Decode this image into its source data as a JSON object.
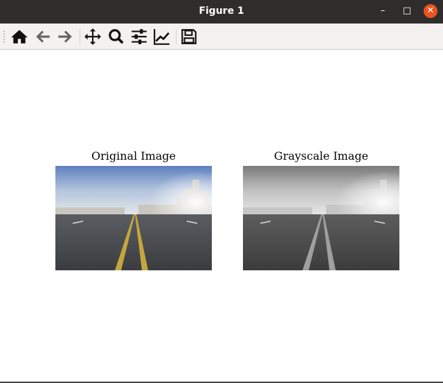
{
  "window": {
    "title": "Figure 1"
  },
  "toolbar": {
    "buttons": [
      "home-icon",
      "back-icon",
      "forward-icon",
      "pan-icon",
      "zoom-icon",
      "configure-subplots-icon",
      "edit-axes-icon",
      "save-icon"
    ]
  },
  "axes": [
    {
      "title": "Original Image",
      "mode": "color"
    },
    {
      "title": "Grayscale Image",
      "mode": "grayscale"
    }
  ],
  "colors": {
    "titlebar": "#2f2d2c",
    "close": "#e95420",
    "lane": "#c4a63e"
  }
}
